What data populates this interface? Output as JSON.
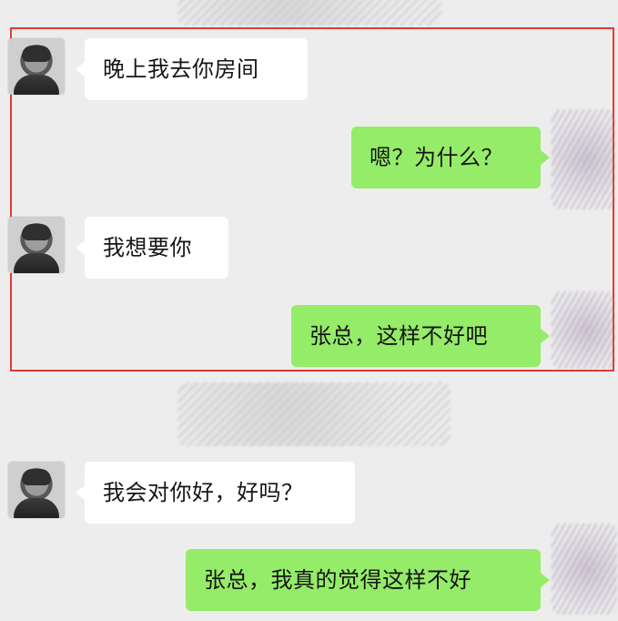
{
  "messages": [
    {
      "side": "left",
      "text": "晚上我去你房间"
    },
    {
      "side": "right",
      "text": "嗯？为什么？"
    },
    {
      "side": "left",
      "text": "我想要你"
    },
    {
      "side": "right",
      "text": "张总，这样不好吧"
    },
    {
      "side": "left",
      "text": "我会对你好，好吗？"
    },
    {
      "side": "right",
      "text": "张总，我真的觉得这样不好"
    }
  ],
  "colors": {
    "background": "#ededed",
    "incoming_bubble": "#ffffff",
    "outgoing_bubble": "#95ec69",
    "highlight_box": "#e53b33"
  },
  "icons": {
    "avatar": "avatar-icon"
  }
}
